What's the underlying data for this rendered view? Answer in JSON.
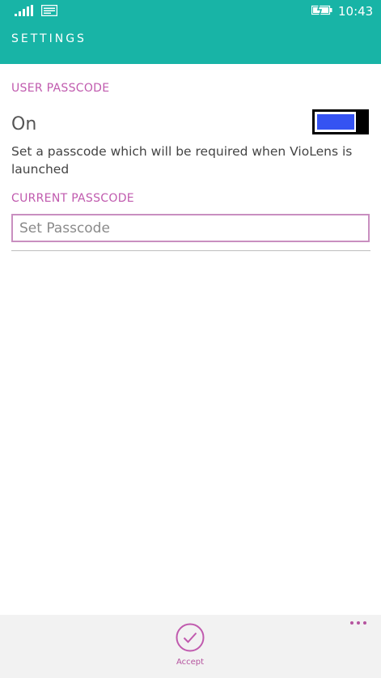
{
  "status_bar": {
    "time": "10:43",
    "icons": [
      "signal-strength-icon",
      "message-icon",
      "battery-charging-icon"
    ]
  },
  "header": {
    "title": "SETTINGS"
  },
  "user_passcode": {
    "section_label": "USER PASSCODE",
    "toggle_state_label": "On",
    "toggle_on": true,
    "description": "Set a passcode which will be required when VioLens is launched"
  },
  "current_passcode": {
    "section_label": "CURRENT PASSCODE",
    "input_value": "",
    "input_placeholder": "Set Passcode"
  },
  "app_bar": {
    "accept_label": "Accept",
    "accept_icon": "check-circle-icon",
    "more_icon": "more-ellipsis-icon"
  },
  "colors": {
    "header_bg": "#18b4a6",
    "accent": "#c05aae",
    "toggle_fill": "#3553f2"
  }
}
